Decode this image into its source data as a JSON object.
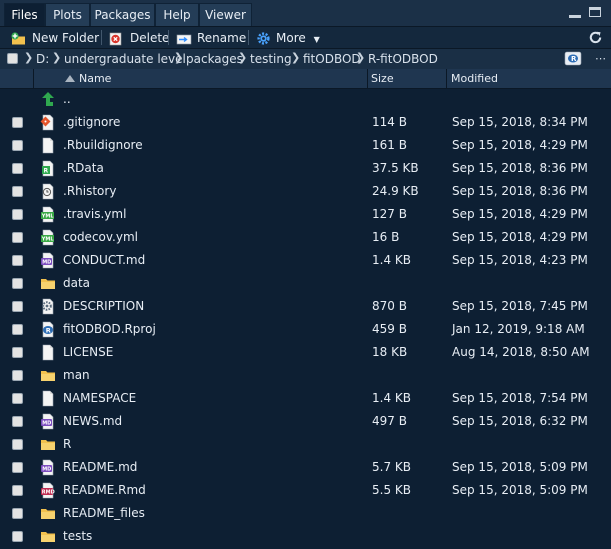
{
  "tabs": [
    {
      "label": "Files",
      "active": true
    },
    {
      "label": "Plots",
      "active": false
    },
    {
      "label": "Packages",
      "active": false
    },
    {
      "label": "Help",
      "active": false
    },
    {
      "label": "Viewer",
      "active": false
    }
  ],
  "toolbar": {
    "new_folder": "New Folder",
    "delete": "Delete",
    "rename": "Rename",
    "more": "More"
  },
  "breadcrumb": [
    "D:",
    "undergraduate level",
    "packages",
    "testing",
    "fitODBOD",
    "R-fitODBOD"
  ],
  "columns": {
    "name": "Name",
    "size": "Size",
    "modified": "Modified"
  },
  "colors": {
    "background": "#0d1f33",
    "accent": "#2d8cff",
    "folder": "#f2c14e"
  },
  "rows": [
    {
      "name": "..",
      "size": "",
      "modified": "",
      "icon": "up-arrow-icon",
      "checkbox": false
    },
    {
      "name": ".gitignore",
      "size": "114 B",
      "modified": "Sep 15, 2018, 8:34 PM",
      "icon": "git-file-icon",
      "checkbox": true
    },
    {
      "name": ".Rbuildignore",
      "size": "161 B",
      "modified": "Sep 15, 2018, 4:29 PM",
      "icon": "text-file-icon",
      "checkbox": true
    },
    {
      "name": ".RData",
      "size": "37.5 KB",
      "modified": "Sep 15, 2018, 8:36 PM",
      "icon": "rdata-file-icon",
      "checkbox": true
    },
    {
      "name": ".Rhistory",
      "size": "24.9 KB",
      "modified": "Sep 15, 2018, 8:36 PM",
      "icon": "history-file-icon",
      "checkbox": true
    },
    {
      "name": ".travis.yml",
      "size": "127 B",
      "modified": "Sep 15, 2018, 4:29 PM",
      "icon": "yaml-file-icon",
      "checkbox": true
    },
    {
      "name": "codecov.yml",
      "size": "16 B",
      "modified": "Sep 15, 2018, 4:29 PM",
      "icon": "yaml-file-icon",
      "checkbox": true
    },
    {
      "name": "CONDUCT.md",
      "size": "1.4 KB",
      "modified": "Sep 15, 2018, 4:23 PM",
      "icon": "markdown-file-icon",
      "checkbox": true
    },
    {
      "name": "data",
      "size": "",
      "modified": "",
      "icon": "folder-icon",
      "checkbox": true
    },
    {
      "name": "DESCRIPTION",
      "size": "870 B",
      "modified": "Sep 15, 2018, 7:45 PM",
      "icon": "description-file-icon",
      "checkbox": true
    },
    {
      "name": "fitODBOD.Rproj",
      "size": "459 B",
      "modified": "Jan 12, 2019, 9:18 AM",
      "icon": "rproj-file-icon",
      "checkbox": true
    },
    {
      "name": "LICENSE",
      "size": "18 KB",
      "modified": "Aug 14, 2018, 8:50 AM",
      "icon": "text-file-icon",
      "checkbox": true
    },
    {
      "name": "man",
      "size": "",
      "modified": "",
      "icon": "folder-icon",
      "checkbox": true
    },
    {
      "name": "NAMESPACE",
      "size": "1.4 KB",
      "modified": "Sep 15, 2018, 7:54 PM",
      "icon": "text-file-icon",
      "checkbox": true
    },
    {
      "name": "NEWS.md",
      "size": "497 B",
      "modified": "Sep 15, 2018, 6:32 PM",
      "icon": "markdown-file-icon",
      "checkbox": true
    },
    {
      "name": "R",
      "size": "",
      "modified": "",
      "icon": "folder-icon",
      "checkbox": true
    },
    {
      "name": "README.md",
      "size": "5.7 KB",
      "modified": "Sep 15, 2018, 5:09 PM",
      "icon": "markdown-file-icon",
      "checkbox": true
    },
    {
      "name": "README.Rmd",
      "size": "5.5 KB",
      "modified": "Sep 15, 2018, 5:09 PM",
      "icon": "rmarkdown-file-icon",
      "checkbox": true
    },
    {
      "name": "README_files",
      "size": "",
      "modified": "",
      "icon": "folder-icon",
      "checkbox": true
    },
    {
      "name": "tests",
      "size": "",
      "modified": "",
      "icon": "folder-icon",
      "checkbox": true
    }
  ]
}
